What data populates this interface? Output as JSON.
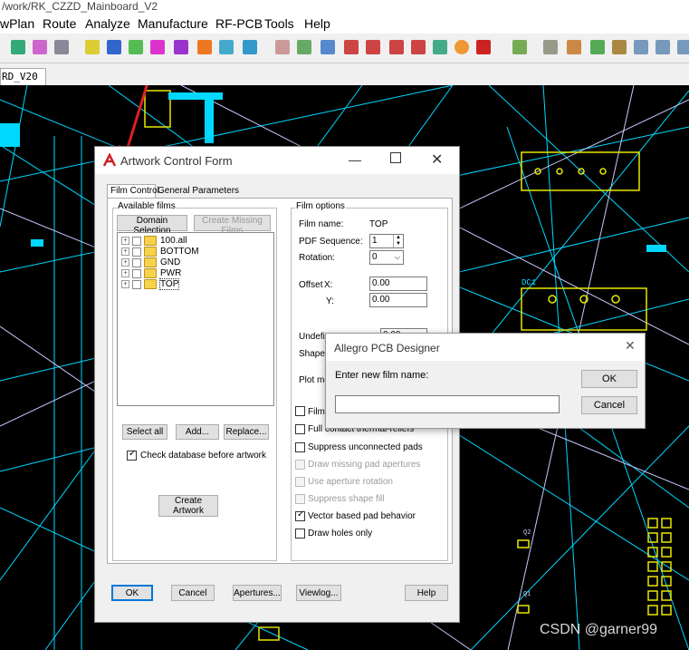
{
  "window": {
    "title_path": "/work/RK_CZZD_Mainboard_V2"
  },
  "menu": [
    "wPlan",
    "Route",
    "Analyze",
    "Manufacture",
    "RF-PCB",
    "Tools",
    "Help"
  ],
  "toolbar": {
    "icons": [
      "property-icon",
      "grid-icon",
      "cmd-icon",
      "route-icon",
      "slide-icon",
      "fanout-icon",
      "via-icon",
      "spread-icon",
      "place-icon",
      "pin-swap-icon",
      "shape-icon",
      "drc-icon",
      "zoom-points-icon",
      "zoom-fit-icon",
      "zoom-in-icon",
      "zoom-out-icon",
      "zoom-world-icon",
      "zoom-center-icon",
      "redraw-icon",
      "3d-icon",
      "flip-icon",
      "grid-toggle-icon",
      "color-icon",
      "layer-icon",
      "stats-icon",
      "report-icon",
      "artwork-icon"
    ]
  },
  "tab": {
    "label": "RD_V20"
  },
  "artwork_form": {
    "title": "Artwork Control Form",
    "tabs": [
      "Film Control",
      "General Parameters"
    ],
    "available_films_label": "Available films",
    "domain_selection": "Domain Selection",
    "create_missing_films": "Create Missing Films",
    "films": [
      "100.all",
      "BOTTOM",
      "GND",
      "PWR",
      "TOP"
    ],
    "buttons": {
      "select_all": "Select all",
      "add": "Add...",
      "replace": "Replace...",
      "create_artwork": "Create Artwork",
      "ok": "OK",
      "cancel": "Cancel",
      "apertures": "Apertures...",
      "viewlog": "Viewlog...",
      "help": "Help"
    },
    "check_database": "Check database before artwork",
    "film_options": {
      "label": "Film options",
      "film_name_label": "Film name:",
      "film_name_value": "TOP",
      "pdf_sequence_label": "PDF Sequence:",
      "pdf_sequence_value": "1",
      "rotation_label": "Rotation:",
      "rotation_value": "0",
      "offset_label": "Offset",
      "x_label": "X:",
      "x_value": "0.00",
      "y_label": "Y:",
      "y_value": "0.00",
      "undefined_label": "Undefi",
      "undefined_value": "0.00",
      "shape_label": "Shape b",
      "plot_mode_label": "Plot mo",
      "film_mirror_label": "Film m",
      "full_contact": "Full contact thermal-reliefs",
      "suppress_pads": "Suppress unconnected pads",
      "draw_missing": "Draw missing pad apertures",
      "aperture_rotation": "Use aperture rotation",
      "suppress_shape": "Suppress shape fill",
      "vector_pad": "Vector based pad behavior",
      "draw_holes": "Draw holes only"
    }
  },
  "prompt": {
    "title": "Allegro PCB Designer",
    "message": "Enter new film name:",
    "input_value": "",
    "ok": "OK",
    "cancel": "Cancel"
  },
  "pcb_labels": [
    "DC1",
    "Q2",
    "Q1"
  ],
  "watermark": "CSDN @garner99",
  "colors": {
    "trace_cyan": "#00d8ff",
    "trace_white": "#d0d0ff",
    "silk_yellow": "#e8e800",
    "annotation_red": "#e02020",
    "canvas": "#000000"
  }
}
